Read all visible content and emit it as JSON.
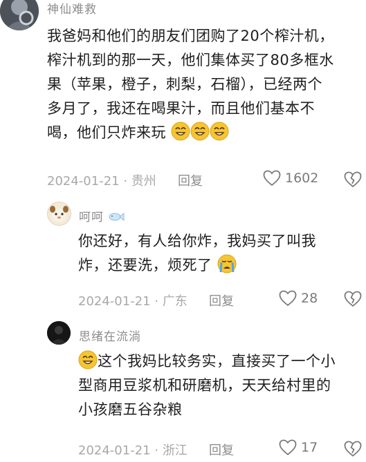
{
  "comments": [
    {
      "username": "神仙难救",
      "lines": [
        "我爸妈和他们的朋友们团购了20个榨汁机，",
        "榨汁机到的那一天，他们集体买了80多框水",
        "果（苹果，橙子，刺梨，石榴），已经两个",
        "多月了，我还在喝果汁，而且他们基本不",
        "喝，他们只炸来玩"
      ],
      "date": "2024-01-21",
      "location": "贵州",
      "reply_label": "回复",
      "likes": "1602"
    },
    {
      "username": "呵呵",
      "lines": [
        "你还好，有人给你炸，我妈买了叫我",
        "炸，还要洗，烦死了"
      ],
      "date": "2024-01-21",
      "location": "广东",
      "reply_label": "回复",
      "likes": "28"
    },
    {
      "username": "思绪在流淌",
      "lines": [
        "这个我妈比较务实，直接买了一个小",
        "型商用豆浆机和研磨机，天天给村里的",
        "小孩磨五谷杂粮"
      ],
      "date": "2024-01-21",
      "location": "浙江",
      "reply_label": "回复",
      "likes": "17"
    }
  ],
  "separator": "·",
  "icons": {
    "like": "heart-outline-icon",
    "dislike": "broken-heart-icon",
    "emoji_grin": "grinning-face-emoji-icon",
    "emoji_cry": "crying-face-emoji-icon",
    "fish": "fish-icon"
  },
  "colors": {
    "text": "#1e1e1e",
    "username": "#8c8c8c",
    "meta": "#a8a8a8",
    "emoji": "#f7c531"
  }
}
